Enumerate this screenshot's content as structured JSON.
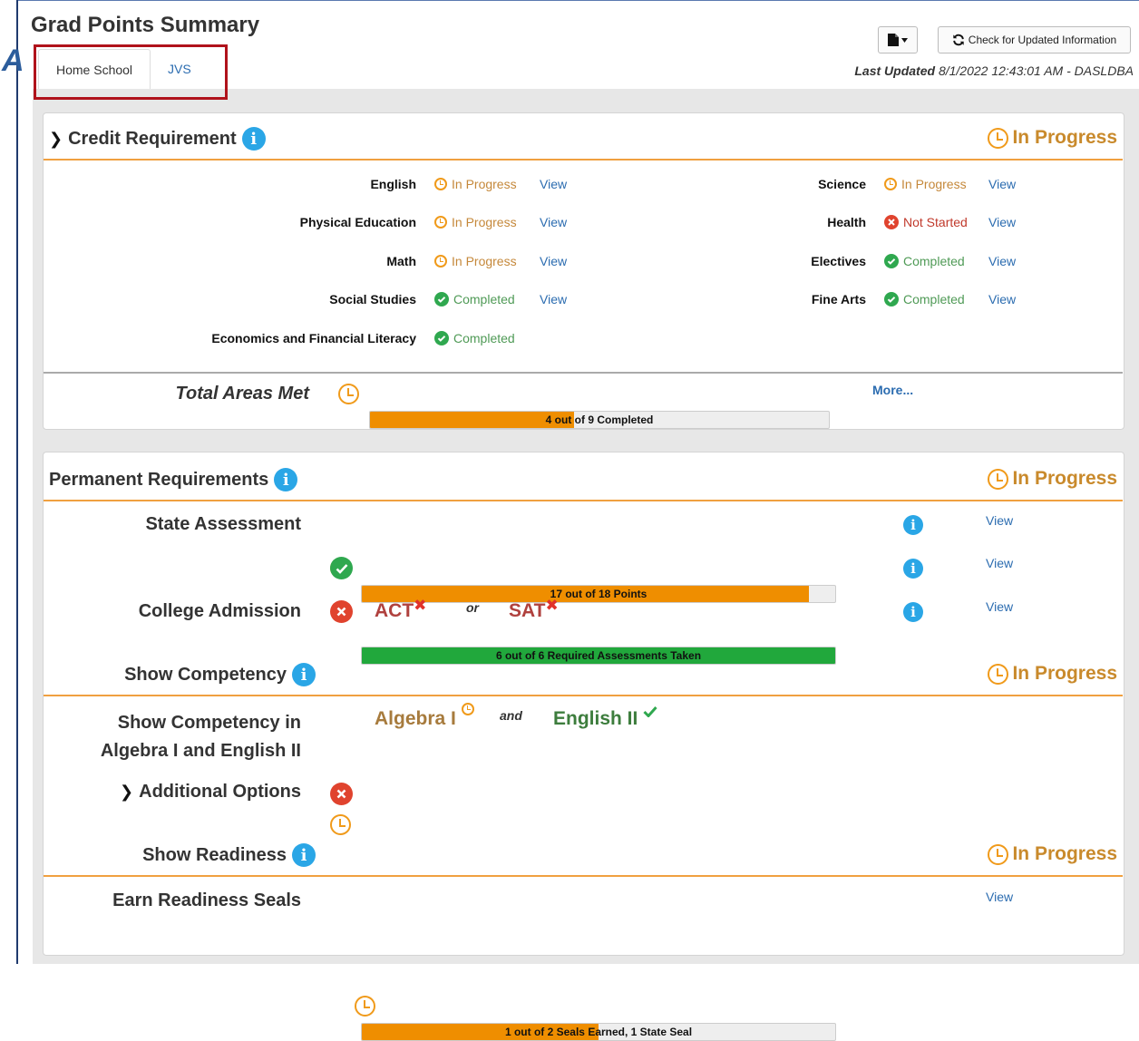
{
  "page": {
    "title": "Grad Points Summary"
  },
  "tabs": [
    {
      "label": "Home School"
    },
    {
      "label": "JVS"
    }
  ],
  "toolbar": {
    "export_icon": "file-export-icon",
    "refresh_label": "Check for Updated Information",
    "last_updated_label": "Last Updated",
    "last_updated_value": "8/1/2022 12:43:01 AM - DASLDBA"
  },
  "credit": {
    "title": "Credit Requirement",
    "status": "In Progress",
    "view_label": "View",
    "rows": [
      {
        "label": "English",
        "status": "In Progress"
      },
      {
        "label": "Physical Education",
        "status": "In Progress"
      },
      {
        "label": "Math",
        "status": "In Progress"
      },
      {
        "label": "Social Studies",
        "status": "Completed"
      },
      {
        "label": "Economics and Financial Literacy",
        "status": "Completed"
      },
      {
        "label": "Science",
        "status": "In Progress"
      },
      {
        "label": "Health",
        "status": "Not Started"
      },
      {
        "label": "Electives",
        "status": "Completed"
      },
      {
        "label": "Fine Arts",
        "status": "Completed"
      }
    ],
    "total": {
      "label": "Total Areas Met",
      "bar_text": "4 out of 9 Completed",
      "progress": 0.444,
      "more_label": "More..."
    }
  },
  "permanent": {
    "title": "Permanent Requirements",
    "status": "In Progress",
    "state_assessment": {
      "label": "State Assessment",
      "points_text": "17 out of 18 Points",
      "points_progress": 0.944,
      "taken_text": "6 out of 6 Required Assessments Taken",
      "taken_progress": 1.0
    },
    "college": {
      "label": "College Admission",
      "act": "ACT",
      "or": "or",
      "sat": "SAT"
    },
    "view_label": "View"
  },
  "competency": {
    "title": "Show Competency",
    "status": "In Progress",
    "row_label_line1": "Show Competency in",
    "row_label_line2": "Algebra I and English II",
    "algebra": "Algebra I",
    "and": "and",
    "english": "English II",
    "additional_options": "Additional Options"
  },
  "readiness": {
    "title": "Show Readiness",
    "status": "In Progress",
    "seals_label": "Earn Readiness Seals",
    "seals_text": "1 out of 2 Seals Earned, 1 State Seal",
    "seals_progress": 0.5,
    "view_label": "View"
  }
}
